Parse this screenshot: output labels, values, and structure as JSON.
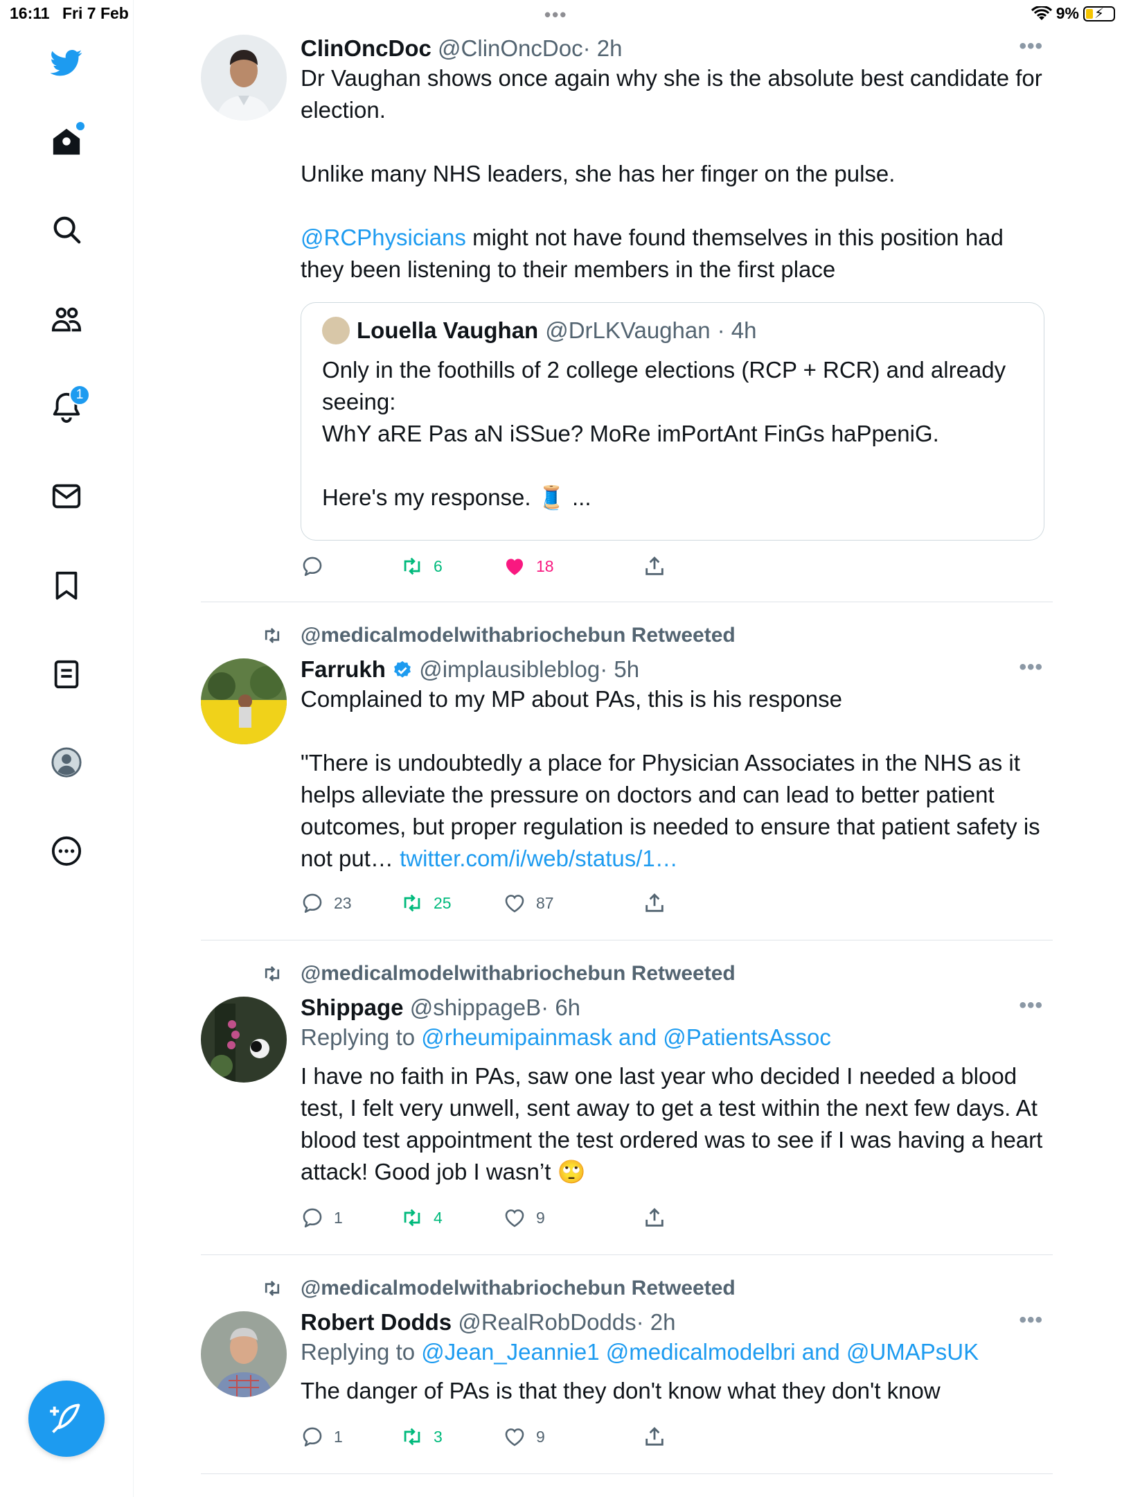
{
  "status": {
    "time": "16:11",
    "date": "Fri 7 Feb",
    "battery": "9%"
  },
  "nav": {
    "notifications_badge": "1"
  },
  "tweets": [
    {
      "name": "ClinOncDoc",
      "handle": "@ClinOncDoc",
      "time": "· 2h",
      "body_1": "Dr Vaughan shows once again why she is the absolute best candidate for election.",
      "body_2": "Unlike many NHS leaders, she has her finger on the pulse.",
      "mention": "@RCPhysicians",
      "body_3": " might not have found themselves in this position had they been listening to their members in the first place",
      "quote": {
        "name": "Louella Vaughan",
        "handle": "@DrLKVaughan",
        "time": "· 4h",
        "line_1": "Only in the foothills of 2 college elections (RCP + RCR) and already seeing:",
        "line_2": "WhY aRE Pas aN iSSue? MoRe imPortAnt FinGs haPpeniG.",
        "line_3": "Here's my response. 🧵 ..."
      },
      "replies": "",
      "retweets": "6",
      "likes": "18"
    },
    {
      "retweeted_by": "@medicalmodelwithabriochebun Retweeted",
      "name": "Farrukh",
      "handle": "@implausibleblog",
      "time": "· 5h",
      "body_1": "Complained to my MP about PAs, this is his response",
      "body_2": "\"There is undoubtedly a place for Physician Associates in the NHS as it helps alleviate the pressure on doctors and can lead to better patient outcomes, but proper regulation is needed to ensure that patient safety is not put… ",
      "link": "twitter.com/i/web/status/1…",
      "replies": "23",
      "retweets": "25",
      "likes": "87"
    },
    {
      "retweeted_by": "@medicalmodelwithabriochebun Retweeted",
      "name": "Shippage",
      "handle": "@shippageB",
      "time": "· 6h",
      "replying_label": "Replying to ",
      "replying_to": "@rheumipainmask and @PatientsAssoc",
      "body_1": "I have no faith in PAs, saw one last year who decided I needed a blood test, I felt very unwell, sent away to get a test within the next few days. At blood test appointment the test ordered was to see if I was having a heart attack! Good job I wasn’t 🙄",
      "replies": "1",
      "retweets": "4",
      "likes": "9"
    },
    {
      "retweeted_by": "@medicalmodelwithabriochebun Retweeted",
      "name": "Robert Dodds",
      "handle": "@RealRobDodds",
      "time": "· 2h",
      "replying_label": "Replying to ",
      "replying_to": "@Jean_Jeannie1 @medicalmodelbri and @UMAPsUK",
      "body_1": "The danger of PAs is that they don't know what they don't know",
      "replies": "1",
      "retweets": "3",
      "likes": "9"
    }
  ]
}
